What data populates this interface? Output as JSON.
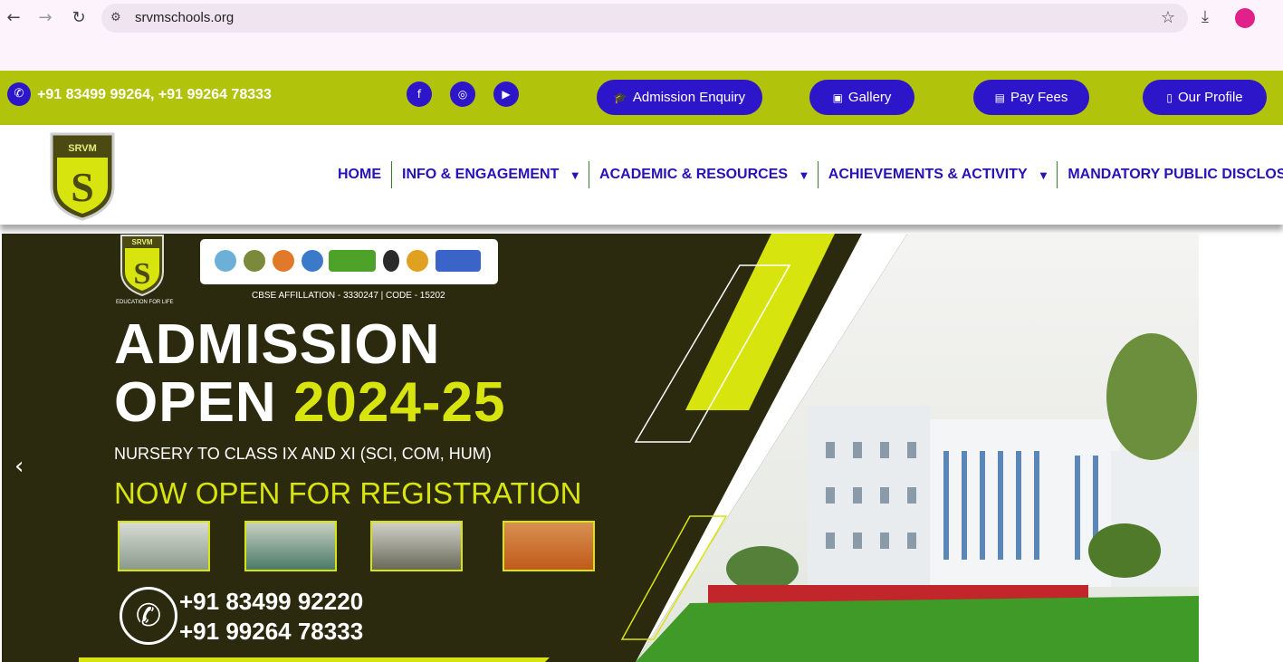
{
  "browser": {
    "url": "srvmschools.org",
    "back_icon": "back-arrow-icon",
    "forward_icon": "forward-arrow-icon",
    "reload_icon": "reload-icon"
  },
  "topbar": {
    "phones": "+91 83499 99264, +91 99264 78333",
    "buttons": {
      "admission": "Admission Enquiry",
      "gallery": "Gallery",
      "fees": "Pay Fees",
      "profile": "Our Profile"
    }
  },
  "logo": {
    "text": "SRVM"
  },
  "menu": {
    "home": "HOME",
    "info": "INFO & ENGAGEMENT",
    "academic": "ACADEMIC & RESOURCES",
    "achievements": "ACHIEVEMENTS & ACTIVITY",
    "disclosure": "MANDATORY PUBLIC DISCLOSURE"
  },
  "hero": {
    "logo_text": "SRVM",
    "tagline": "EDUCATION FOR LIFE",
    "cbse": "CBSE AFFILLATION - 3330247 | CODE - 15202",
    "line1": "ADMISSION",
    "line2a": "OPEN",
    "line2b": "2024-25",
    "classes": "NURSERY TO CLASS IX AND XI (SCI, COM, HUM)",
    "register": "NOW OPEN FOR REGISTRATION",
    "phone1": "+91 83499 92220",
    "phone2": "+91 99264 78333"
  },
  "colors": {
    "accent_green": "#b2c30b",
    "brand_blue": "#2d16c9",
    "hero_dark": "#2b2a0f",
    "hero_yellow": "#d8e40d"
  }
}
